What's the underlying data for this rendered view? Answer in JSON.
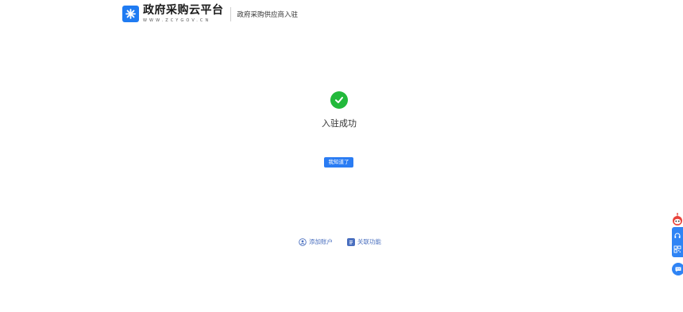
{
  "header": {
    "logo_title": "政府采购云平台",
    "logo_domain": "WWW.ZCYGOV.CN",
    "subtitle": "政府采购供应商入驻"
  },
  "result": {
    "title": "入驻成功",
    "ack_button": "我知道了"
  },
  "links": [
    {
      "label": "添加账户",
      "icon": "add-account-icon"
    },
    {
      "label": "关联功能",
      "icon": "related-feature-icon"
    }
  ],
  "side_toolbar": {
    "icons": [
      "mascot-icon",
      "headset-icon",
      "qrcode-icon",
      "chat-icon"
    ]
  },
  "colors": {
    "brand_blue": "#1f7bf2",
    "button_blue": "#2a7cf3",
    "success_green": "#22b93b",
    "link_blue": "#4a6fbf"
  }
}
